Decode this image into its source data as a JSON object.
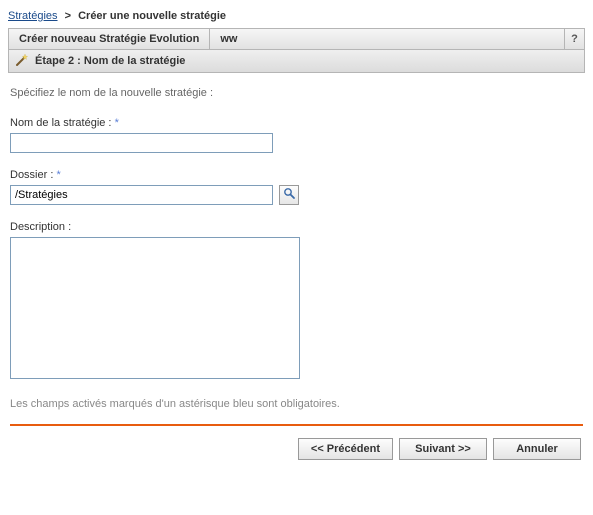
{
  "breadcrumb": {
    "root": "Stratégies",
    "sep": ">",
    "current": "Créer une nouvelle stratégie"
  },
  "panel": {
    "title_left": "Créer nouveau Stratégie Evolution",
    "title_right": "ww",
    "help": "?"
  },
  "step": {
    "label": "Étape 2 : Nom de la stratégie"
  },
  "form": {
    "intro": "Spécifiez le nom de la nouvelle stratégie :",
    "name_label": "Nom de la stratégie :",
    "name_value": "",
    "folder_label": "Dossier :",
    "folder_value": "/Stratégies",
    "desc_label": "Description :",
    "desc_value": "",
    "required_mark": "*",
    "footnote": "Les champs activés marqués d'un astérisque bleu sont obligatoires."
  },
  "buttons": {
    "previous": "<< Précédent",
    "next": "Suivant >>",
    "cancel": "Annuler"
  }
}
